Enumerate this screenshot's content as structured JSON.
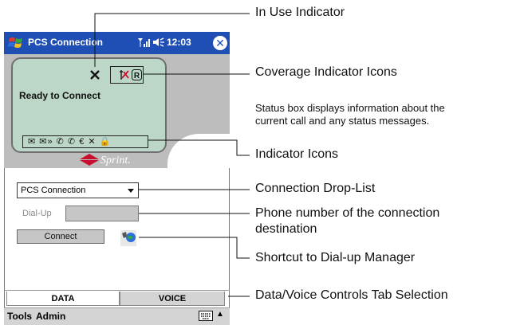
{
  "titlebar": {
    "title": "PCS Connection",
    "time": "12:03",
    "close_glyph": "✕"
  },
  "status": {
    "text": "Ready to Connect",
    "indicator_icons": "✉ ✉» ✆ ✆ € ✕ 🔒",
    "brand": "Sprint."
  },
  "controls": {
    "connection_value": "PCS Connection",
    "dialup_label": "Dial-Up",
    "dialup_value": "",
    "connect_label": "Connect"
  },
  "tabs": [
    {
      "label": "DATA"
    },
    {
      "label": "VOICE"
    }
  ],
  "menubar": {
    "tools": "Tools",
    "admin": "Admin"
  },
  "callouts": {
    "in_use": "In Use Indicator",
    "coverage": "Coverage Indicator Icons",
    "status_line1": "Status box displays information about the",
    "status_line2": "current call and any status messages.",
    "indicator_icons": "Indicator Icons",
    "connection_droplist": "Connection Drop-List",
    "phone_line1": "Phone number of the connection",
    "phone_line2": "destination",
    "shortcut": "Shortcut to Dial-up Manager",
    "tab_selection": "Data/Voice Controls Tab Selection"
  },
  "colors": {
    "titlebar": "#1f4fb4",
    "lcd": "#bcd7c8",
    "sprint_red": "#c8102e",
    "panel": "#bdbdbd"
  }
}
